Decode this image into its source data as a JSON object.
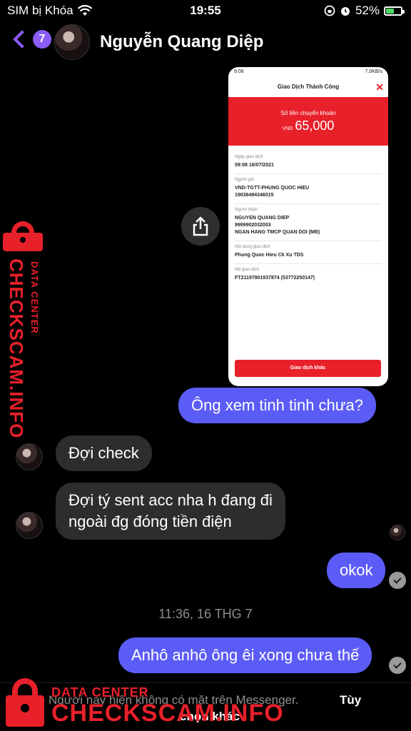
{
  "status_bar": {
    "carrier": "SIM bị Khóa",
    "time": "19:55",
    "battery": "52%",
    "battery_level": 0.52
  },
  "header": {
    "unread_count": "7",
    "contact_name": "Nguyễn Quang Diệp"
  },
  "shared_image": {
    "status_time": "9:08",
    "status_right": "7,0KB/s",
    "title": "Giao Dịch Thành Công",
    "amount_label": "Số tiền chuyển khoản",
    "currency": "VND",
    "amount": "65,000",
    "fields": [
      {
        "label": "Ngày giao dịch",
        "value": "09:08 16/07/2021"
      },
      {
        "label": "Người gửi",
        "value": "VND-TGTT-PHUNG QUOC HIEU\n19036494346015"
      },
      {
        "label": "Người nhận",
        "value": "NGUYEN QUANG DIEP\n9999902032003\nNGAN HANG TMCP QUAN DOI (MB)"
      },
      {
        "label": "Nội dung giao dịch",
        "value": "Phung Quoc Hieu Ck Xu TDS"
      },
      {
        "label": "Mã giao dịch",
        "value": "FT21197901937874 (53772250147)"
      }
    ],
    "button": "Giao dịch khác"
  },
  "messages": {
    "m1": "Ông xem tinh tinh chưa?",
    "m2": "Đợi check",
    "m3_line1": "Đợi tý sent acc nha h đang đi",
    "m3_line2": "ngoài đg đóng tiền điện",
    "m4": "okok",
    "timestamp": "11:36, 16 THG 7",
    "m5": "Anhô anhô ông êi xong chưa thế"
  },
  "footer": {
    "notice": "Người này hiện không có mặt trên Messenger.",
    "link_part1": "Tùy",
    "link_part2": "chọn khác"
  },
  "watermark": {
    "data_center": "DATA CENTER",
    "site": "CHECKSCAM.INFO"
  },
  "colors": {
    "outgoing_bubble": "#5b5cf6",
    "incoming_bubble": "#2d2d30",
    "accent": "#8b5cf6",
    "bank_red": "#e8202a"
  }
}
